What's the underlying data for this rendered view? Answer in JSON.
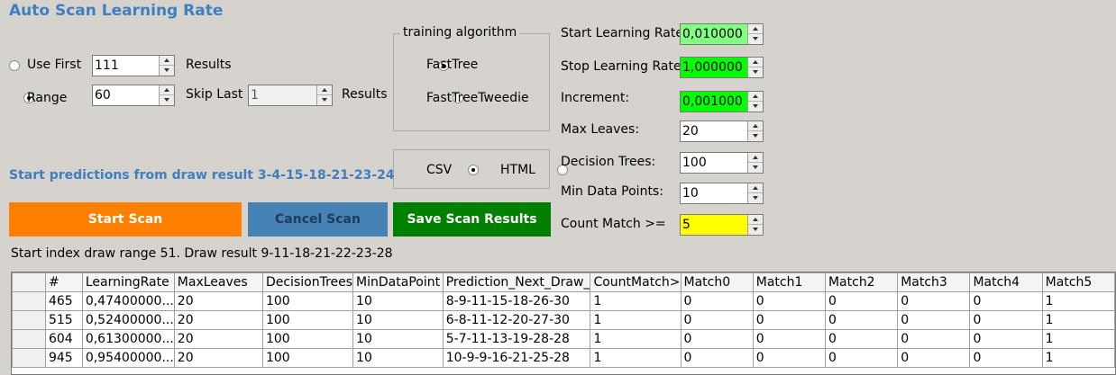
{
  "title": "Auto Scan Learning Rate",
  "use_first": {
    "label": "Use First",
    "value": "111",
    "suffix": "Results",
    "selected": false
  },
  "range": {
    "label": "Range",
    "value": "60",
    "skip_label": "Skip Last",
    "skip_value": "1",
    "suffix": "Results",
    "selected": true
  },
  "algorithm": {
    "title": "training algorithm",
    "options": [
      {
        "label": "FastTree",
        "selected": true
      },
      {
        "label": "FastTreeTweedie",
        "selected": false
      }
    ]
  },
  "format": {
    "options": [
      {
        "label": "CSV",
        "selected": true
      },
      {
        "label": "HTML",
        "selected": false
      }
    ]
  },
  "params": {
    "start_lr": {
      "label": "Start Learning Rate:",
      "value": "0,010000",
      "color": "#80ff80"
    },
    "stop_lr": {
      "label": "Stop Learning Rate:",
      "value": "1,000000",
      "color": "#00ff00"
    },
    "increment": {
      "label": "Increment:",
      "value": "0,001000",
      "color": "#00ff00"
    },
    "max_leaves": {
      "label": "Max Leaves:",
      "value": "20"
    },
    "decision_trees": {
      "label": "Decision Trees:",
      "value": "100"
    },
    "min_data_points": {
      "label": "Min Data Points:",
      "value": "10"
    },
    "count_match": {
      "label": "Count Match >=",
      "value": "5",
      "color": "#ffff00"
    }
  },
  "predictions_text": "Start predictions from draw result 3-4-15-18-21-23-24",
  "buttons": {
    "start": {
      "label": "Start Scan",
      "color": "#ff8000"
    },
    "cancel": {
      "label": "Cancel Scan",
      "color": "#4682b4"
    },
    "save": {
      "label": "Save Scan Results",
      "color": "#008000"
    }
  },
  "status_text": "Start index draw range 51. Draw result 9-11-18-21-22-23-28",
  "grid": {
    "columns": [
      "#",
      "LearningRate",
      "MaxLeaves",
      "DecisionTrees",
      "MinDataPoint",
      "Prediction_Next_Draw_",
      "CountMatch>",
      "Match0",
      "Match1",
      "Match2",
      "Match3",
      "Match4",
      "Match5"
    ],
    "rows": [
      [
        "465",
        "0,47400000...",
        "20",
        "100",
        "10",
        "8-9-11-15-18-26-30",
        "1",
        "0",
        "0",
        "0",
        "0",
        "0",
        "1"
      ],
      [
        "515",
        "0,52400000...",
        "20",
        "100",
        "10",
        "6-8-11-12-20-27-30",
        "1",
        "0",
        "0",
        "0",
        "0",
        "0",
        "1"
      ],
      [
        "604",
        "0,61300000...",
        "20",
        "100",
        "10",
        "5-7-11-13-19-28-28",
        "1",
        "0",
        "0",
        "0",
        "0",
        "0",
        "1"
      ],
      [
        "945",
        "0,95400000...",
        "20",
        "100",
        "10",
        "10-9-9-16-21-25-28",
        "1",
        "0",
        "0",
        "0",
        "0",
        "0",
        "1"
      ]
    ]
  }
}
